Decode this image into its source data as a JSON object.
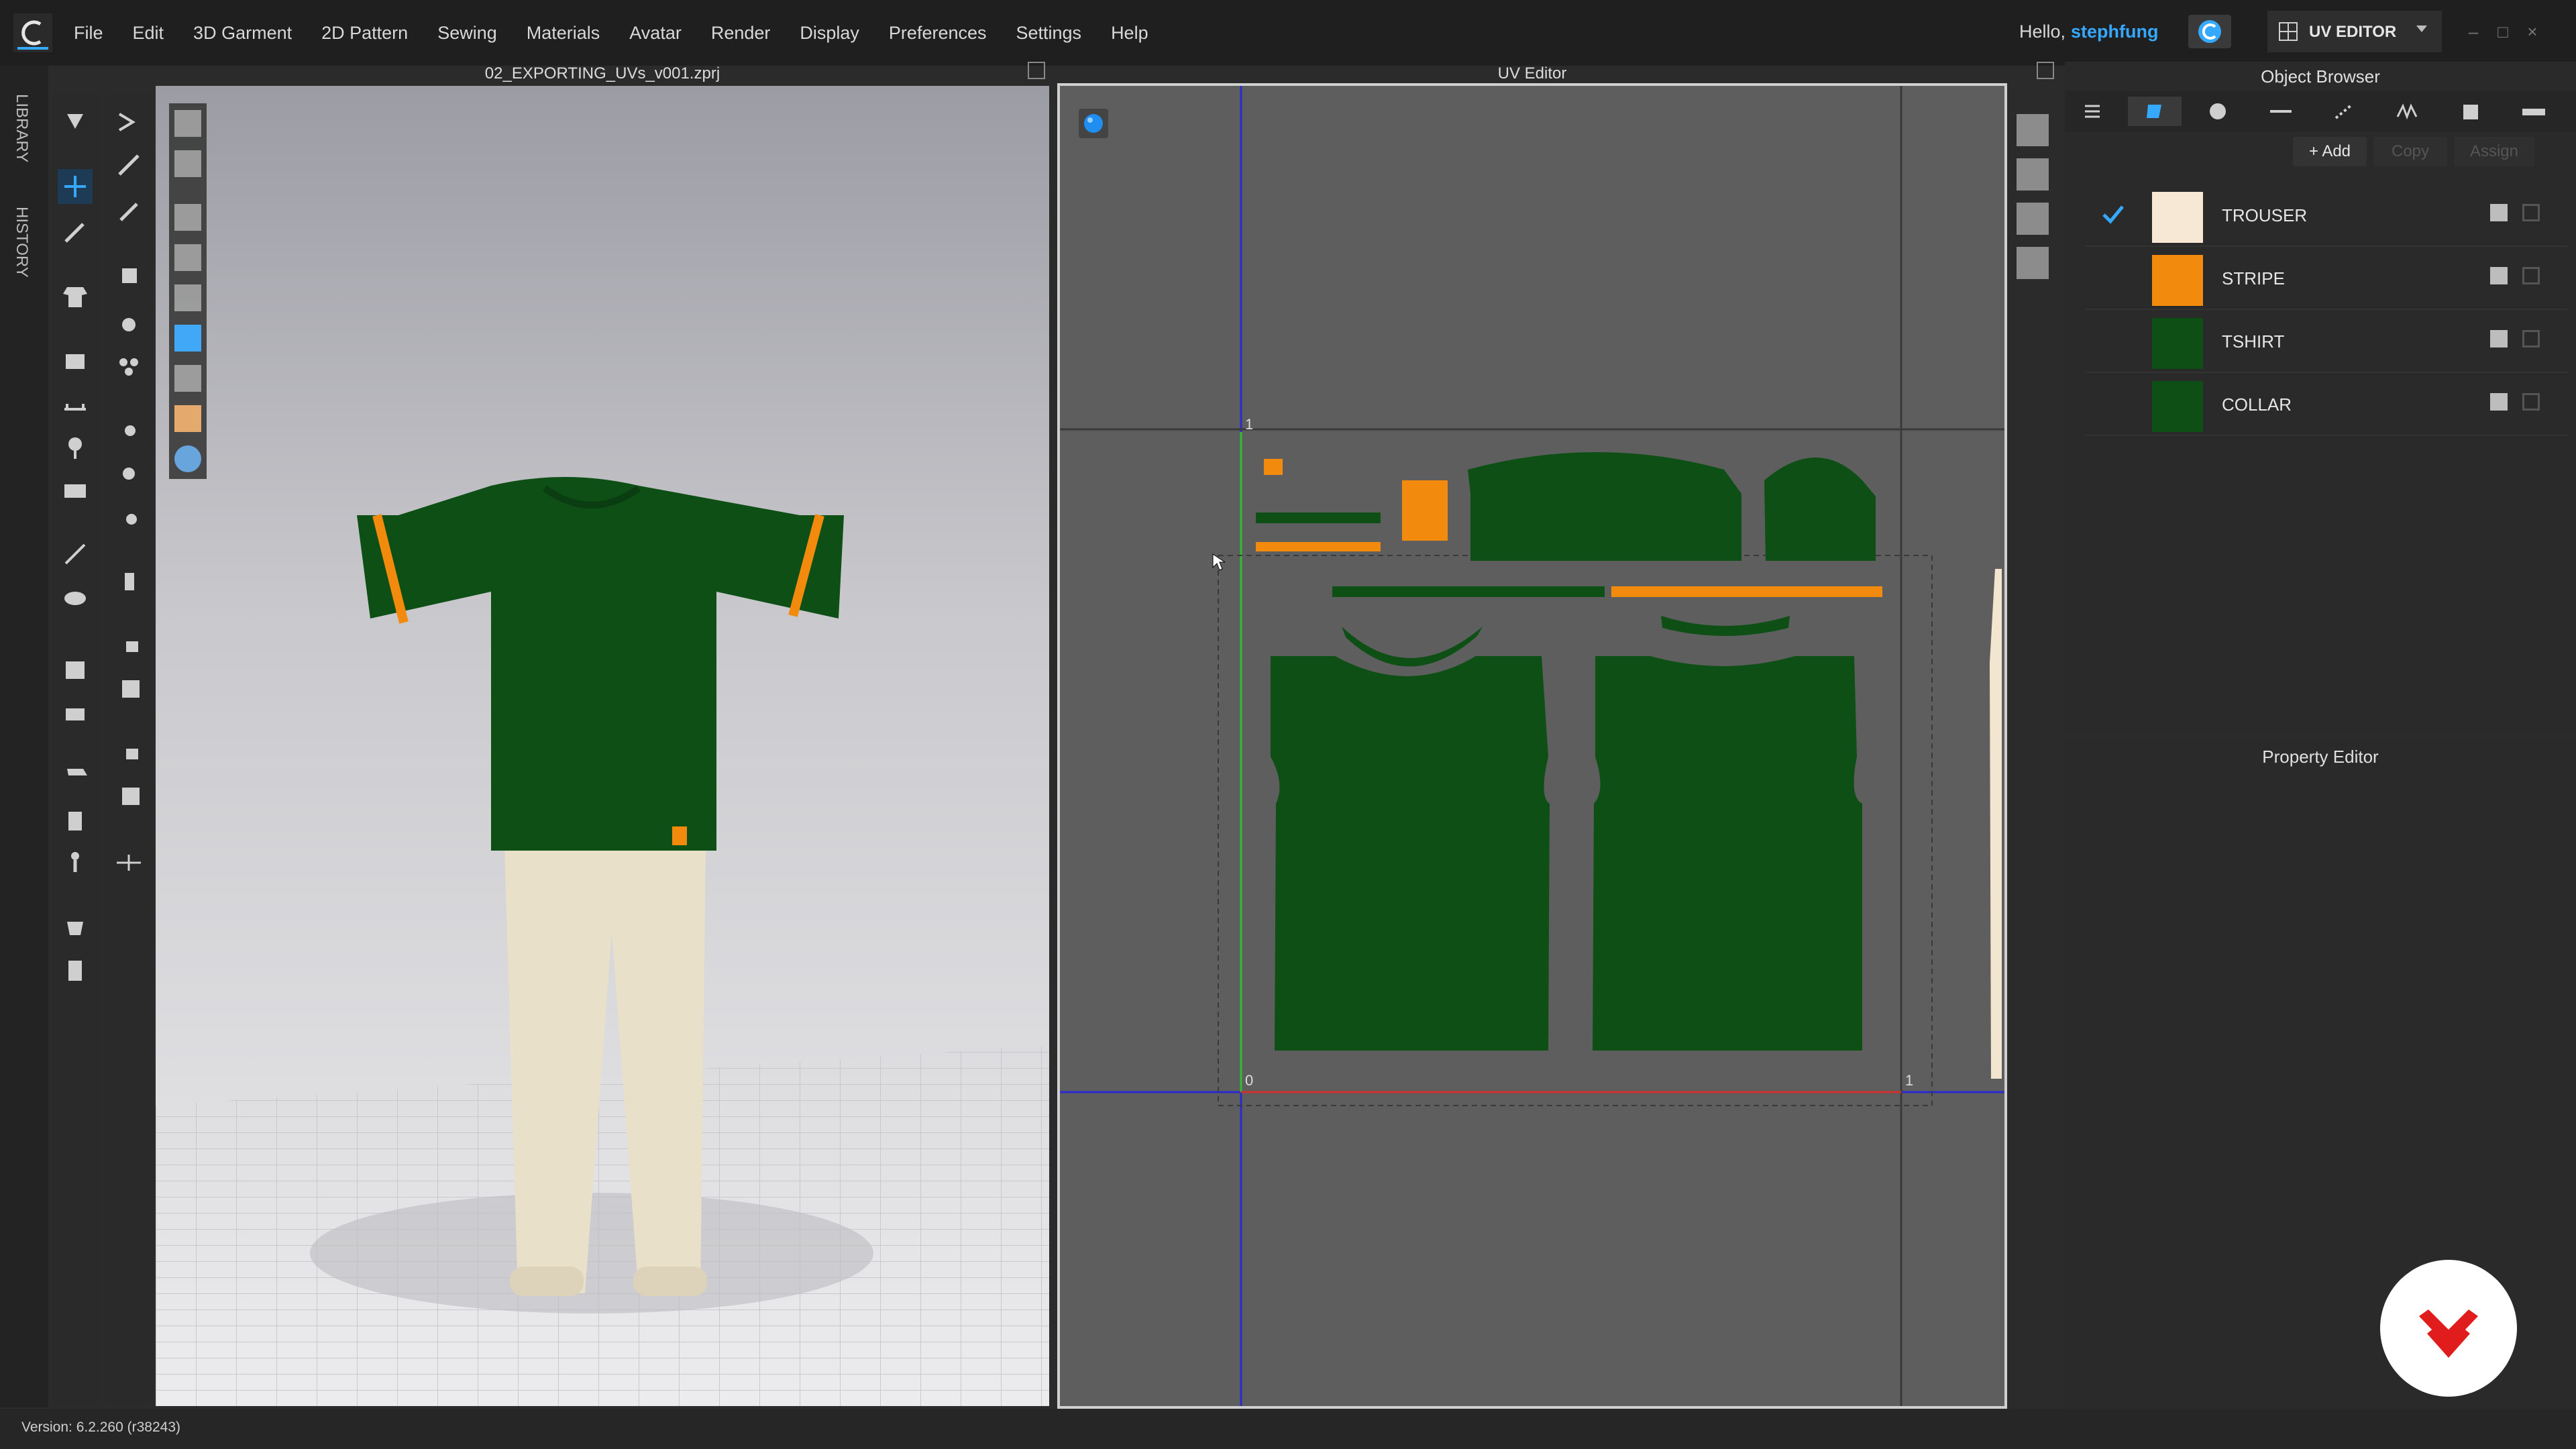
{
  "menu": [
    "File",
    "Edit",
    "3D Garment",
    "2D Pattern",
    "Sewing",
    "Materials",
    "Avatar",
    "Render",
    "Display",
    "Preferences",
    "Settings",
    "Help"
  ],
  "user": {
    "greeting": "Hello,",
    "name": "stephfung"
  },
  "mode": {
    "label": "UV EDITOR"
  },
  "vtabs": {
    "library": "LIBRARY",
    "history": "HISTORY"
  },
  "viewport3d": {
    "title": "02_EXPORTING_UVs_v001.zprj"
  },
  "uv_editor": {
    "title": "UV Editor",
    "label_top": "1",
    "label_origin": "0",
    "label_right": "1"
  },
  "object_browser": {
    "title": "Object Browser",
    "actions": {
      "add": "+ Add",
      "copy": "Copy",
      "assign": "Assign"
    },
    "fabrics": [
      {
        "name": "TROUSER",
        "color": "#f7e8d5",
        "selected": true
      },
      {
        "name": "STRIPE",
        "color": "#f28a0d",
        "selected": false
      },
      {
        "name": "TSHIRT",
        "color": "#0e4f16",
        "selected": false
      },
      {
        "name": "COLLAR",
        "color": "#0e4f16",
        "selected": false
      }
    ]
  },
  "property_editor": {
    "title": "Property Editor"
  },
  "status": {
    "version": "Version: 6.2.260 (r38243)"
  },
  "colors": {
    "accent": "#35a8ff",
    "garment_green": "#0e4f16",
    "stripe_orange": "#f28a0d",
    "trouser_cream": "#e9e0c9",
    "brand_red": "#e01c1c"
  }
}
